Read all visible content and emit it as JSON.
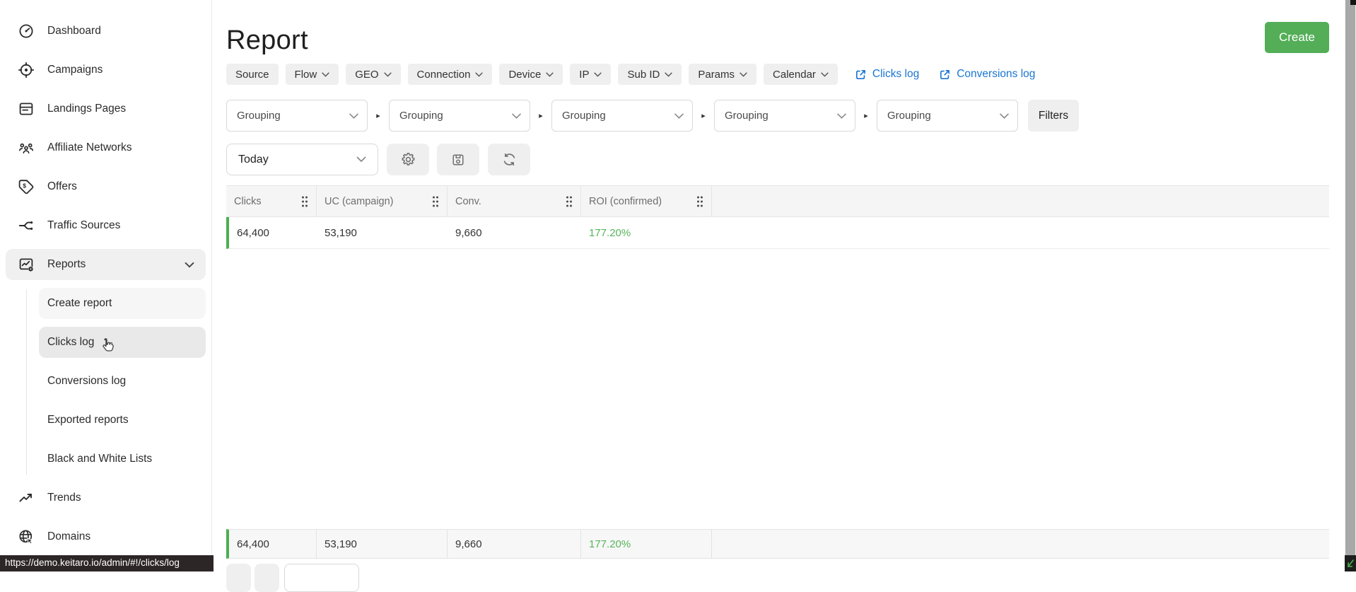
{
  "sidebar": {
    "items": [
      {
        "label": "Dashboard",
        "icon": "dashboard-icon"
      },
      {
        "label": "Campaigns",
        "icon": "target-icon"
      },
      {
        "label": "Landings Pages",
        "icon": "document-icon"
      },
      {
        "label": "Affiliate Networks",
        "icon": "people-icon"
      },
      {
        "label": "Offers",
        "icon": "price-tag-icon"
      },
      {
        "label": "Traffic Sources",
        "icon": "branch-icon"
      },
      {
        "label": "Reports",
        "icon": "report-chart-icon",
        "active": true,
        "expanded": true
      }
    ],
    "submenu": {
      "items": [
        {
          "label": "Create report"
        },
        {
          "label": "Clicks log",
          "hovered": true
        },
        {
          "label": "Conversions log"
        },
        {
          "label": "Exported reports"
        },
        {
          "label": "Black and White Lists"
        }
      ]
    },
    "bottom_items": [
      {
        "label": "Trends",
        "icon": "trending-up-icon"
      },
      {
        "label": "Domains",
        "icon": "globe-cursor-icon"
      }
    ]
  },
  "status_bar": {
    "url": "https://demo.keitaro.io/admin/#!/clicks/log"
  },
  "header": {
    "title": "Report",
    "create_button": "Create"
  },
  "filter_chips": {
    "items": [
      {
        "label": "Source",
        "has_chevron": false
      },
      {
        "label": "Flow",
        "has_chevron": true
      },
      {
        "label": "GEO",
        "has_chevron": true
      },
      {
        "label": "Connection",
        "has_chevron": true
      },
      {
        "label": "Device",
        "has_chevron": true
      },
      {
        "label": "IP",
        "has_chevron": true
      },
      {
        "label": "Sub ID",
        "has_chevron": true
      },
      {
        "label": "Params",
        "has_chevron": true
      },
      {
        "label": "Calendar",
        "has_chevron": true
      }
    ]
  },
  "log_links": {
    "clicks": "Clicks log",
    "conversions": "Conversions log"
  },
  "grouping": {
    "placeholder": "Grouping",
    "select_count": 5,
    "filters_button": "Filters"
  },
  "toolbar": {
    "date_range": "Today"
  },
  "report_table": {
    "columns": [
      {
        "label": "Clicks"
      },
      {
        "label": "UC (campaign)"
      },
      {
        "label": "Conv."
      },
      {
        "label": "ROI (confirmed)"
      }
    ],
    "row": {
      "clicks": "64,400",
      "uc": "53,190",
      "conv": "9,660",
      "roi": "177.20%"
    },
    "summary": {
      "clicks": "64,400",
      "uc": "53,190",
      "conv": "9,660",
      "roi": "177.20%"
    }
  },
  "colors": {
    "accent_green": "#4caf50",
    "roi_green": "#56b45a",
    "link_blue": "#1976d2",
    "create_button_green": "#53ae57",
    "active_item_gray": "#f0f0f0",
    "status_bar_dark": "#2d2626"
  }
}
